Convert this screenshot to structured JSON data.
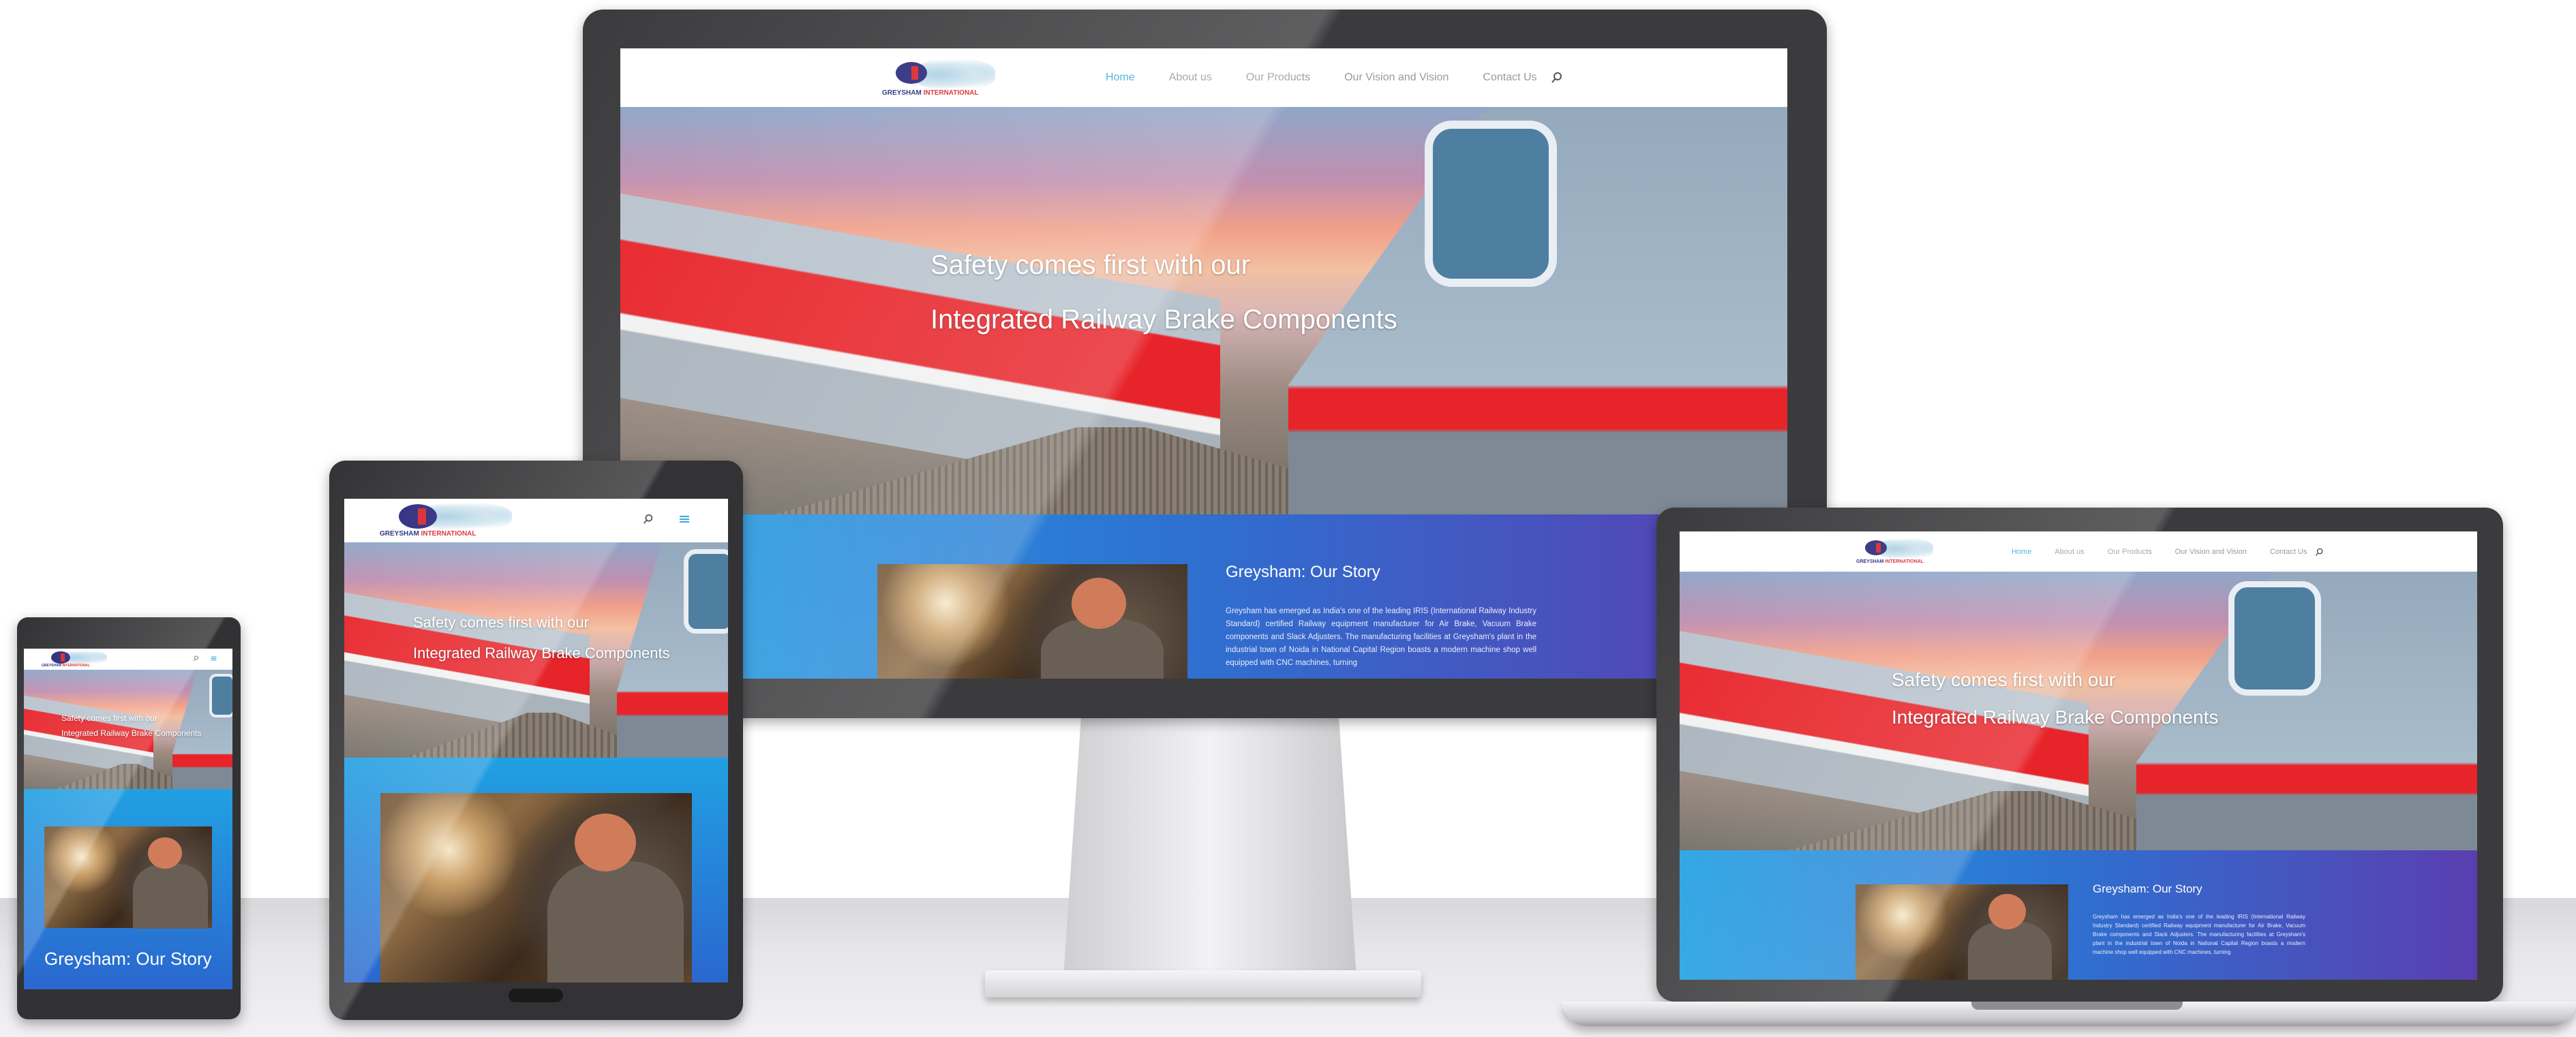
{
  "site": {
    "logo_text_main": "GREYSHAM",
    "logo_text_accent": "INTERNATIONAL",
    "nav": [
      "Home",
      "About us",
      "Our Products",
      "Our Vision and Vision",
      "Contact Us"
    ],
    "active_nav": "Home",
    "hero_line1": "Safety comes first with our",
    "hero_line2": "Integrated Railway Brake Components",
    "story_title": "Greysham: Our Story",
    "story_body": "Greysham has emerged as India's one of the leading IRIS (International Railway Industry Standard) certified Railway equipment manufacturer for Air Brake, Vacuum Brake components and Slack Adjusters. The manufacturing facilities at Greysham's plant in the industrial town of Noida in National Capital Region boasts a modern machine shop well equipped with CNC machines, turning"
  },
  "colors": {
    "nav_active": "#3fa9d8",
    "story_gradient_start": "#21a0e2",
    "story_gradient_end": "#5a3eb0",
    "logo_blue": "#232a7a",
    "logo_red": "#d9262b"
  },
  "icons": {
    "search": "search-icon",
    "menu": "hamburger-menu-icon"
  }
}
